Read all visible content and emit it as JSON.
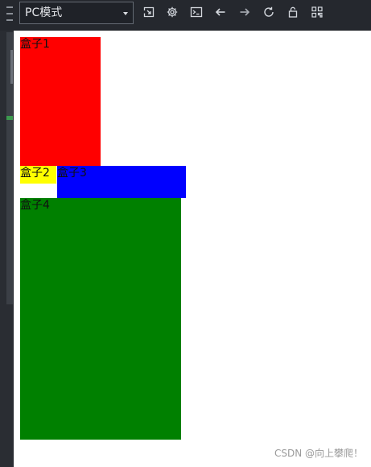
{
  "toolbar": {
    "mode_select": {
      "value": "PC模式"
    },
    "icons": [
      "expand-window-icon",
      "gear-icon",
      "terminal-icon",
      "arrow-left-icon",
      "arrow-right-icon",
      "refresh-icon",
      "unlock-icon",
      "grid-icon"
    ]
  },
  "canvas": {
    "boxes": [
      {
        "label": "盒子1",
        "color": "#ff0000"
      },
      {
        "label": "盒子2",
        "color": "#ffff00"
      },
      {
        "label": "盒子3",
        "color": "#0000ff"
      },
      {
        "label": "盒子4",
        "color": "#008000"
      }
    ]
  },
  "watermark": "CSDN @向上攀爬！",
  "colors": {
    "toolbar_bg": "#25282e",
    "select_border": "#646a73",
    "icon_color": "#d5d9df",
    "gutter_bg": "#2a2d33"
  }
}
